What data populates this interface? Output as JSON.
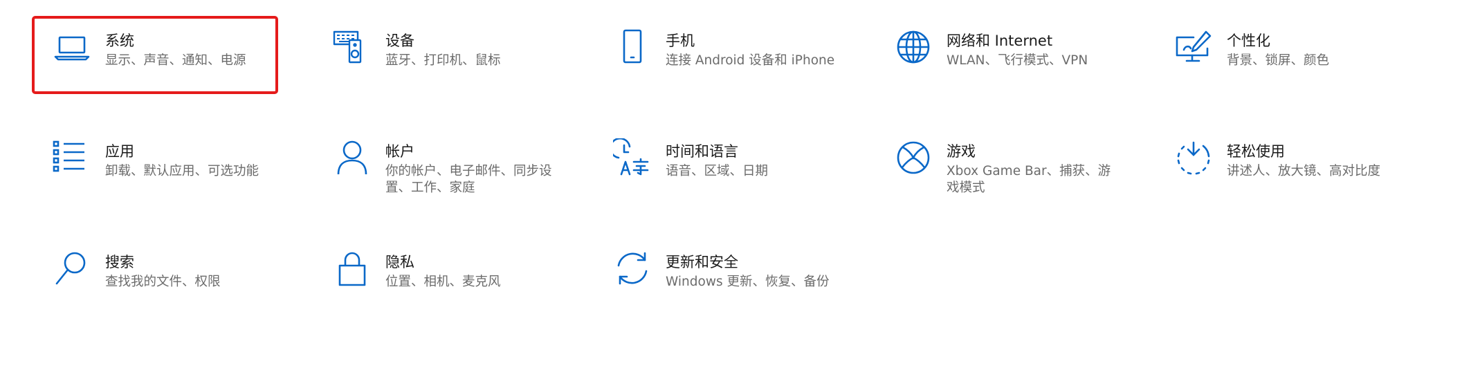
{
  "accent_color": "#0a68c8",
  "highlight_color": "#e51b1b",
  "selected_tile": "system",
  "tiles": [
    {
      "id": "system",
      "icon": "laptop-icon",
      "title": "系统",
      "desc": "显示、声音、通知、电源"
    },
    {
      "id": "devices",
      "icon": "devices-icon",
      "title": "设备",
      "desc": "蓝牙、打印机、鼠标"
    },
    {
      "id": "phone",
      "icon": "phone-icon",
      "title": "手机",
      "desc": "连接 Android 设备和 iPhone"
    },
    {
      "id": "network",
      "icon": "globe-icon",
      "title": "网络和 Internet",
      "desc": "WLAN、飞行模式、VPN"
    },
    {
      "id": "personalization",
      "icon": "personalization-icon",
      "title": "个性化",
      "desc": "背景、锁屏、颜色"
    },
    {
      "id": "apps",
      "icon": "apps-list-icon",
      "title": "应用",
      "desc": "卸载、默认应用、可选功能"
    },
    {
      "id": "accounts",
      "icon": "person-icon",
      "title": "帐户",
      "desc": "你的帐户、电子邮件、同步设置、工作、家庭"
    },
    {
      "id": "time-language",
      "icon": "time-language-icon",
      "title": "时间和语言",
      "desc": "语音、区域、日期"
    },
    {
      "id": "gaming",
      "icon": "xbox-icon",
      "title": "游戏",
      "desc": "Xbox Game Bar、捕获、游戏模式"
    },
    {
      "id": "ease-of-access",
      "icon": "ease-of-access-icon",
      "title": "轻松使用",
      "desc": "讲述人、放大镜、高对比度"
    },
    {
      "id": "search",
      "icon": "search-icon",
      "title": "搜索",
      "desc": "查找我的文件、权限"
    },
    {
      "id": "privacy",
      "icon": "lock-icon",
      "title": "隐私",
      "desc": "位置、相机、麦克风"
    },
    {
      "id": "update-security",
      "icon": "refresh-icon",
      "title": "更新和安全",
      "desc": "Windows 更新、恢复、备份"
    }
  ]
}
